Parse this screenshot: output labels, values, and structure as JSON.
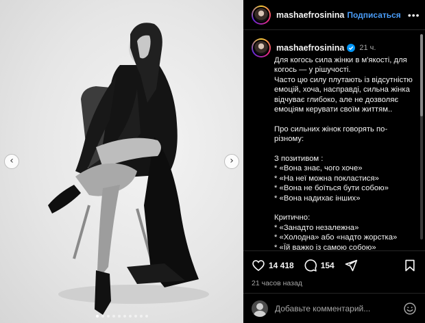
{
  "post": {
    "username": "mashaefrosinina",
    "follow_label": "Подписаться",
    "more_label": "•••",
    "time_short": "21 ч.",
    "caption_lines": [
      "Для когось сила жінки  в м'якості, для",
      "когось — у рішучості.",
      "Часто цю силу плутають із відсутністю",
      "емоцій, хоча, насправді, сильна жінка",
      "відчуває глибоко, але не дозволяє",
      "емоціям керувати своїм життям..",
      "",
      "Про сильних жінок говорять по-",
      "різному:",
      "",
      "З позитивом :",
      "*  «Вона знає, чого хоче»",
      "*  «На неї можна покластися»",
      "*  «Вона не боїться бути собою»",
      "*  «Вона надихає інших»",
      "",
      "Критично:",
      "*  «Занадто незалежна»",
      "*  «Холодна» або «надто жорстка»",
      "*  «Їй важко із самою собою»"
    ],
    "likes": "14 418",
    "comments": "154",
    "posted_label": "21 часов назад"
  },
  "media": {
    "prev_glyph": "‹",
    "next_glyph": "›",
    "dot_count": 10,
    "active_dot": 0
  },
  "comment": {
    "placeholder": "Добавьте комментарий..."
  },
  "icons": {
    "heart": "heart-icon",
    "comment": "comment-icon",
    "share": "share-icon",
    "bookmark": "bookmark-icon",
    "emoji": "emoji-icon",
    "verified": "verified-badge-icon"
  },
  "colors": {
    "background": "#000000",
    "accent": "#4a9df8",
    "muted": "#a8a8a8"
  }
}
